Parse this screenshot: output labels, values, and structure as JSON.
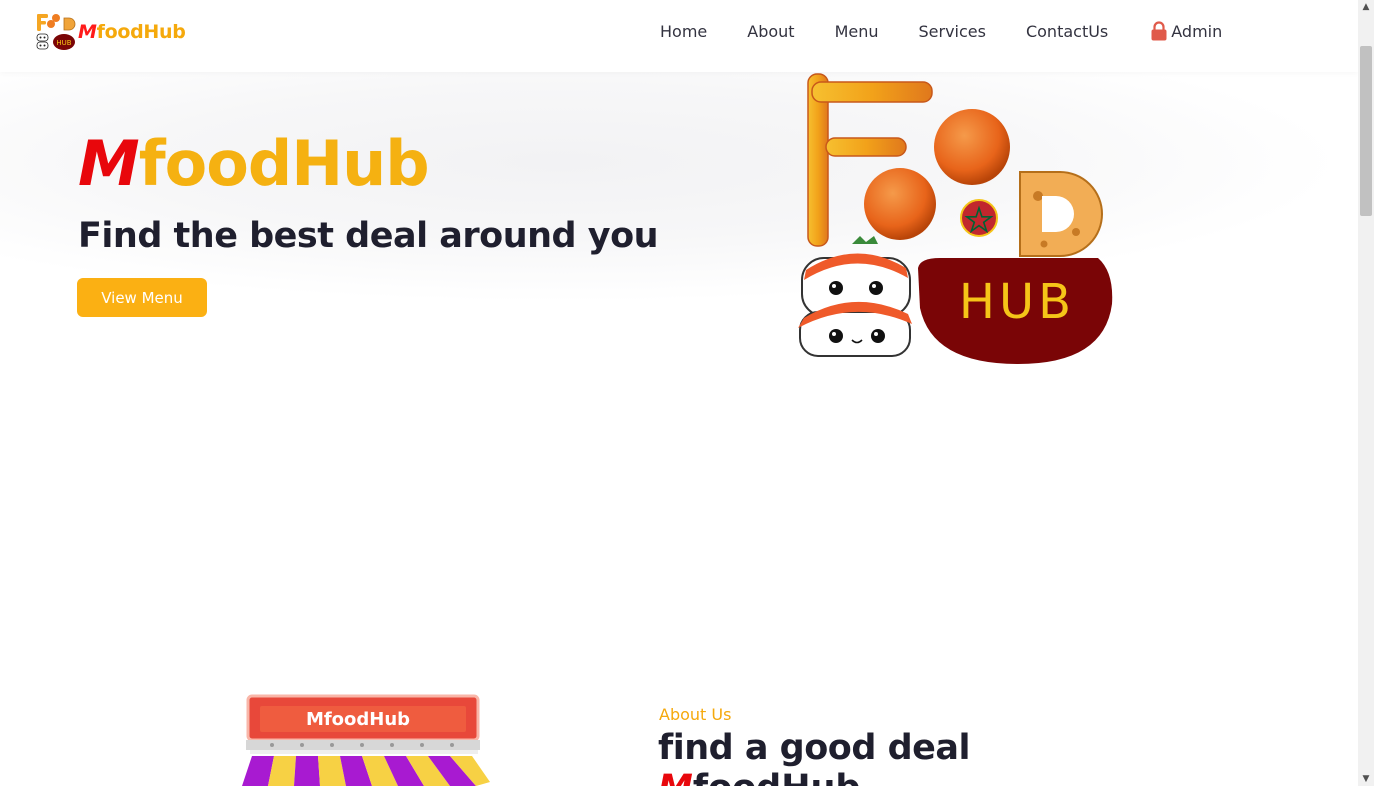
{
  "brand": {
    "prefix": "M",
    "rest": "foodHub"
  },
  "nav": {
    "items": [
      "Home",
      "About",
      "Menu",
      "Services",
      "ContactUs"
    ],
    "admin": "Admin"
  },
  "hero": {
    "title_prefix": "M",
    "title_rest": "foodHub",
    "subtitle": "Find the best deal around you",
    "button": "View Menu",
    "logo": {
      "letters_top": "FOOD",
      "letters_bottom": "HUB"
    }
  },
  "about": {
    "label": "About Us",
    "heading": "find a good deal",
    "brand_prefix": "M",
    "brand_rest": "foodHub",
    "store_sign": "MfoodHub"
  },
  "colors": {
    "accent": "#f5b111",
    "brand_red": "#e8070c",
    "button": "#fbb013",
    "hub_dark_red": "#7a0506",
    "text_dark": "#1f1f2e"
  },
  "icons": {
    "admin": "lock-icon"
  }
}
